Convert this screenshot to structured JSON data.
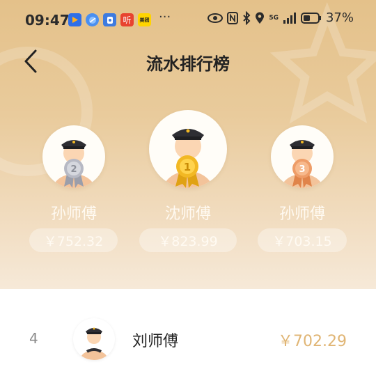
{
  "status_bar": {
    "time": "09:47",
    "icons": [
      "play-app-icon",
      "browser-app-icon",
      "shield-app-icon",
      "listen-app-icon",
      "meituan-app-icon"
    ],
    "listen_label": "听",
    "meituan_label": "美团",
    "more": "···",
    "network": "5G",
    "battery": "37%"
  },
  "nav": {
    "title": "流水排行榜"
  },
  "podium": {
    "second": {
      "rank": "2",
      "name": "孙师傅",
      "amount": "￥752.32"
    },
    "first": {
      "rank": "1",
      "name": "沈师傅",
      "amount": "￥823.99"
    },
    "third": {
      "rank": "3",
      "name": "孙师傅",
      "amount": "￥703.15"
    }
  },
  "list": [
    {
      "rank": "4",
      "name": "刘师傅",
      "amount": "￥702.29"
    }
  ],
  "colors": {
    "hero_top": "#e4c18a",
    "hero_bottom": "#f6e9d8",
    "amount_accent": "#e0b574",
    "gold_medal": "#f2b824",
    "silver_medal": "#b7b9c4",
    "bronze_medal": "#ee9d68"
  }
}
